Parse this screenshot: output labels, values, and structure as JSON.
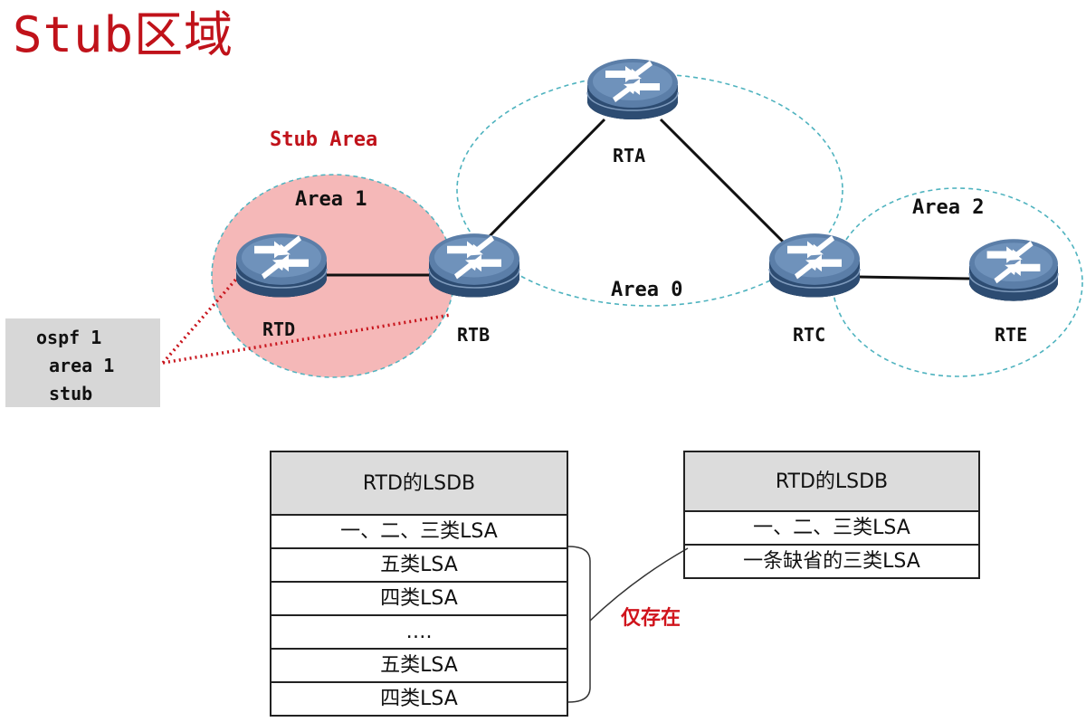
{
  "title": "Stub区域",
  "stub_area_label": "Stub Area",
  "areas": {
    "area1": "Area 1",
    "area0": "Area 0",
    "area2": "Area 2"
  },
  "routers": {
    "rta": "RTA",
    "rtb": "RTB",
    "rtc": "RTC",
    "rtd": "RTD",
    "rte": "RTE"
  },
  "config": {
    "line1": "ospf 1",
    "line2": "area 1",
    "line3": "stub"
  },
  "lsdb_left": {
    "header": "RTD的LSDB",
    "rows": [
      "一、二、三类LSA",
      "五类LSA",
      "四类LSA",
      "….",
      "五类LSA",
      "四类LSA"
    ]
  },
  "lsdb_right": {
    "header": "RTD的LSDB",
    "rows": [
      "一、二、三类LSA",
      "一条缺省的三类LSA"
    ]
  },
  "note": "仅存在",
  "colors": {
    "title": "#c0121a",
    "stub_area_fill": "#f5b8b8",
    "area_dashed_outline": "#4fb3bf",
    "router_body": "#2b4a6e",
    "router_top": "#5d7fa6",
    "annotation_red": "#d0141c",
    "config_bg": "#d7d7d7",
    "table_header_bg": "#dcdcdc"
  }
}
